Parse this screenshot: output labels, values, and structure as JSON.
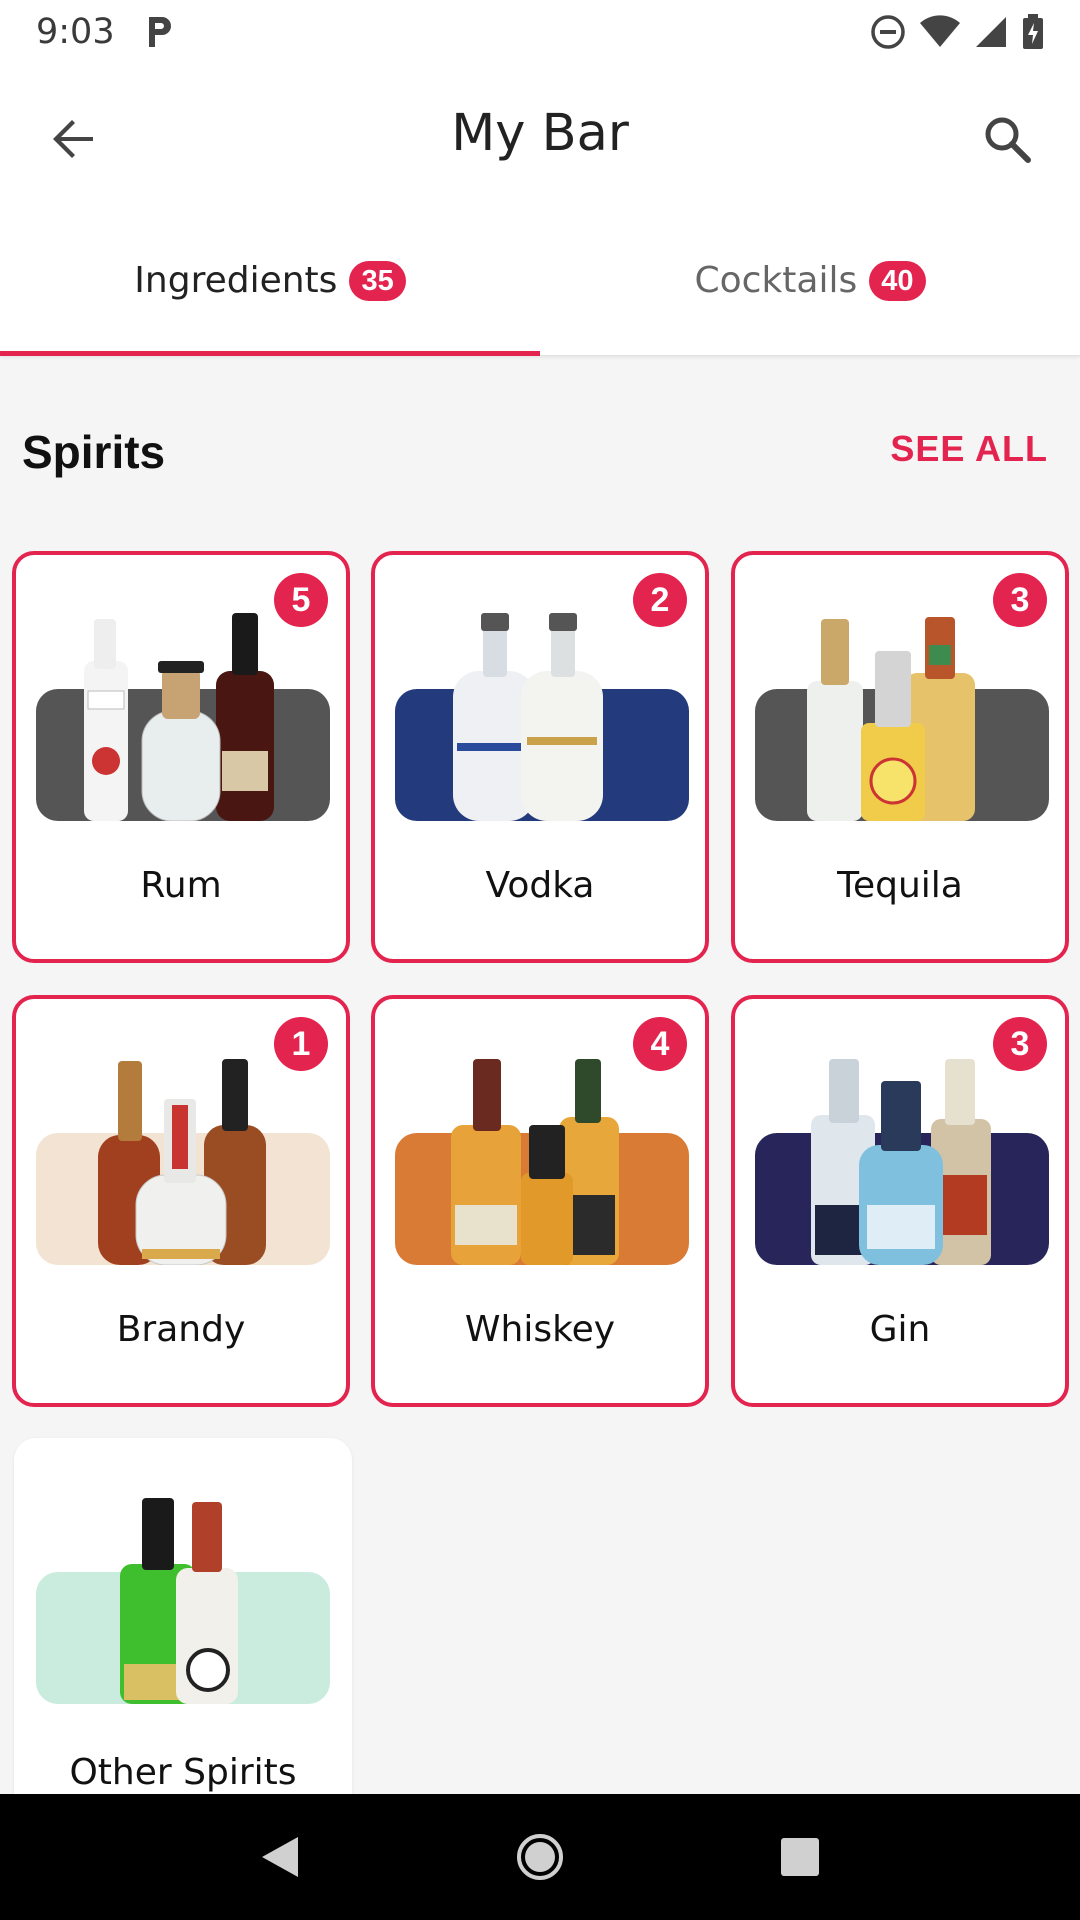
{
  "status_bar": {
    "time": "9:03"
  },
  "app_bar": {
    "title": "My Bar"
  },
  "tabs": [
    {
      "label": "Ingredients",
      "count": "35",
      "active": true
    },
    {
      "label": "Cocktails",
      "count": "40",
      "active": false
    }
  ],
  "section": {
    "title": "Spirits",
    "see_all": "SEE ALL"
  },
  "cards": [
    {
      "label": "Rum",
      "count": "5",
      "panel_color": "#555555"
    },
    {
      "label": "Vodka",
      "count": "2",
      "panel_color": "#233a7c"
    },
    {
      "label": "Tequila",
      "count": "3",
      "panel_color": "#555555"
    },
    {
      "label": "Brandy",
      "count": "1",
      "panel_color": "#f3e3d2"
    },
    {
      "label": "Whiskey",
      "count": "4",
      "panel_color": "#d97a35"
    },
    {
      "label": "Gin",
      "count": "3",
      "panel_color": "#272559"
    },
    {
      "label": "Other Spirits",
      "count": "",
      "panel_color": "#c9ecdf"
    }
  ],
  "colors": {
    "accent": "#e3244f",
    "background": "#f5f5f5"
  }
}
